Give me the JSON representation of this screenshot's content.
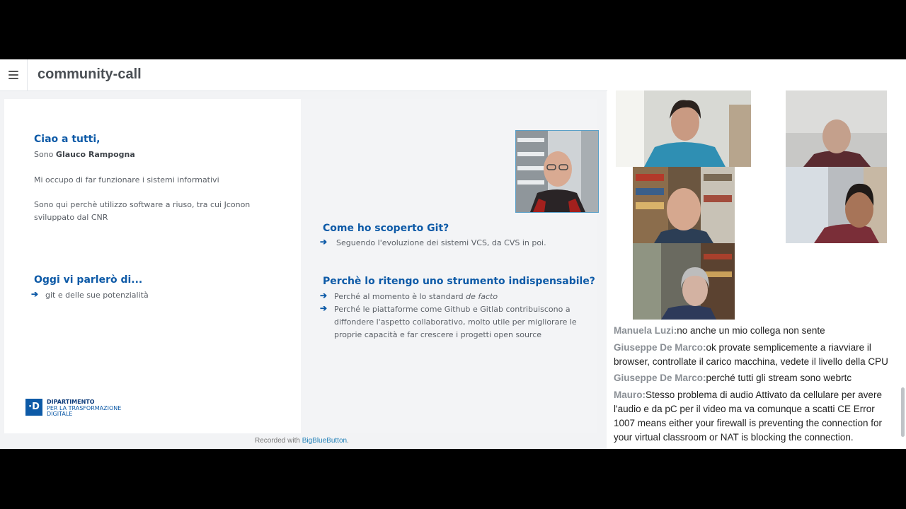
{
  "app": {
    "title": "community-call"
  },
  "slides": {
    "left": {
      "greeting": "Ciao a tutti,",
      "intro_prefix": "Sono",
      "intro_name": "Glauco Rampogna",
      "line1": "Mi occupo di far funzionare i sistemi informativi",
      "line2": "Sono qui perchè utilizzo software a riuso, tra cui Jconon sviluppato dal CNR",
      "topic_heading": "Oggi vi parlerò di...",
      "topic_bullet": "git e delle sue potenzialità",
      "logo": {
        "line1": "DIPARTIMENTO",
        "line2": "PER LA TRASFORMAZIONE",
        "line3": "DIGITALE",
        "mark": "·D"
      }
    },
    "right": {
      "heading1": "Come ho scoperto Git?",
      "bullet1": "Seguendo l'evoluzione dei sistemi VCS, da CVS in poi.",
      "heading2": "Perchè lo ritengo uno strumento indispensabile?",
      "bullet2_prefix": "Perché al momento è lo standard ",
      "bullet2_italic": "de facto",
      "bullet3": "Perché le piattaforme come Github e Gitlab contribuiscono a diffondere l'aspetto collaborativo, molto utile per migliorare le proprie capacità e far crescere i progetti open source"
    }
  },
  "recorded": {
    "prefix": "Recorded with ",
    "link": "BigBlueButton",
    "suffix": "."
  },
  "chat": [
    {
      "name": "Manuela Luzi:",
      "text": "no anche un mio collega non sente"
    },
    {
      "name": "Giuseppe De Marco:",
      "text": "ok provate semplicemente a riavviare il browser, controllate il carico macchina, vedete il livello della CPU"
    },
    {
      "name": "Giuseppe De Marco:",
      "text": "perché tutti gli stream sono webrtc"
    },
    {
      "name": "Mauro:",
      "text": "Stesso problema di audio Attivato da cellulare per avere l'audio e da pC per il video ma va comunque a scatti CE Error 1007 means either your firewall is preventing the connection for your virtual classroom or NAT is blocking the connection."
    }
  ],
  "colors": {
    "accent": "#0d5aa7",
    "link": "#1f7fb7",
    "chat_name": "#8a8f95"
  }
}
